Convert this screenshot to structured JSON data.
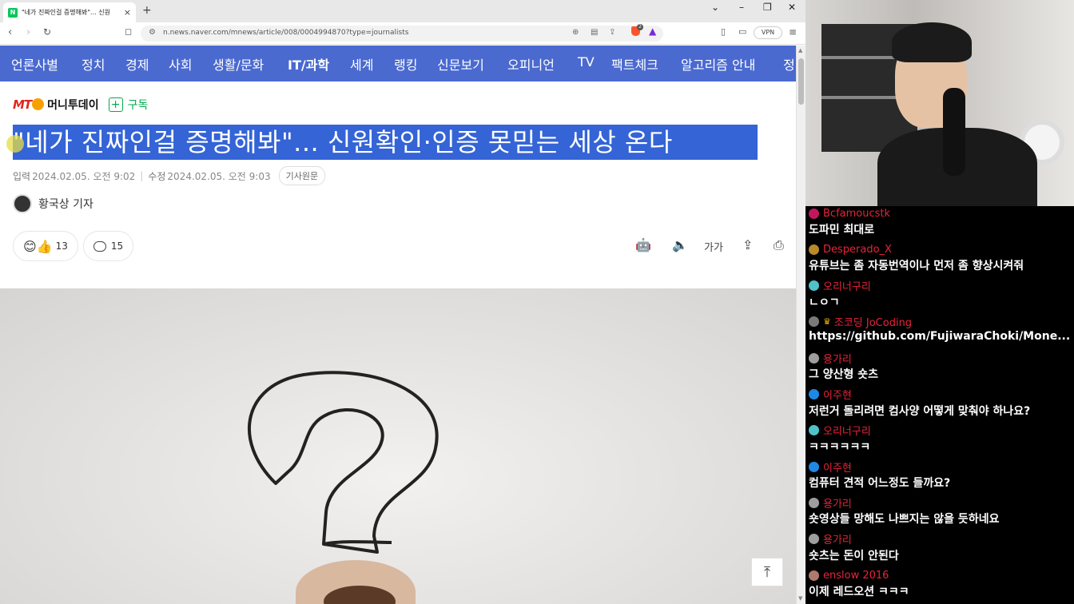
{
  "browser": {
    "tab_title": "\"네가 진짜인걸 증명해봐\"... 신원",
    "url": "n.news.naver.com/mnews/article/008/0004994870?type=journalists",
    "vpn_label": "VPN",
    "brave_badge": "2"
  },
  "gnb": {
    "items": [
      "언론사별",
      "정치",
      "경제",
      "사회",
      "생활/문화",
      "IT/과학",
      "세계",
      "랭킹",
      "신문보기",
      "오피니언",
      "TV",
      "팩트체크",
      "알고리즘 안내",
      "정"
    ],
    "active_index": 5
  },
  "article": {
    "press_logo": "MT",
    "press_name": "머니투데이",
    "subscribe_label": "구독",
    "headline": "\"네가 진짜인걸 증명해봐\"... 신원확인·인증 못믿는 세상 온다",
    "input_label": "입력",
    "input_date": "2024.02.05. 오전 9:02",
    "modified_label": "수정",
    "modified_date": "2024.02.05. 오전 9:03",
    "original_label": "기사원문",
    "reporter": "황국상 기자",
    "reaction_count": "13",
    "comment_count": "15",
    "font_tool_label": "가가"
  },
  "chat": [
    {
      "user": "Bcfamoucstk",
      "text": "도파민 최대로",
      "badge_color": "#c2185b"
    },
    {
      "user": "Desperado_X",
      "text": "유튜브는 좀 자동번역이나 먼저 좀 향상시켜줘",
      "badge_color": "#b88a2a"
    },
    {
      "user": "오리너구리",
      "text": "ㄴㅇㄱ",
      "badge_color": "#4fc3c9"
    },
    {
      "user": "조코딩 JoCoding",
      "text": "https://github.com/FujiwaraChoki/Mone...",
      "badge_color": "#7a7a7a",
      "crown": true
    },
    {
      "user": "용가리",
      "text": "그 양산형 숏츠",
      "badge_color": "#9e9e9e"
    },
    {
      "user": "이주현",
      "text": "저런거 돌리려면 컴사양 어떻게 맞춰야 하나요?",
      "badge_color": "#1e88e5"
    },
    {
      "user": "오리너구리",
      "text": "ㅋㅋㅋㅋㅋㅋ",
      "badge_color": "#4fc3c9"
    },
    {
      "user": "이주현",
      "text": "컴퓨터 견적 어느정도 들까요?",
      "badge_color": "#1e88e5"
    },
    {
      "user": "용가리",
      "text": "숏영상들 망해도 나쁘지는 않을 듯하네요",
      "badge_color": "#9e9e9e"
    },
    {
      "user": "용가리",
      "text": "숏츠는 돈이 안된다",
      "badge_color": "#9e9e9e"
    },
    {
      "user": "enslow 2016",
      "text": "이제 레드오션 ㅋㅋㅋ",
      "badge_color": "#b07a6a"
    }
  ]
}
